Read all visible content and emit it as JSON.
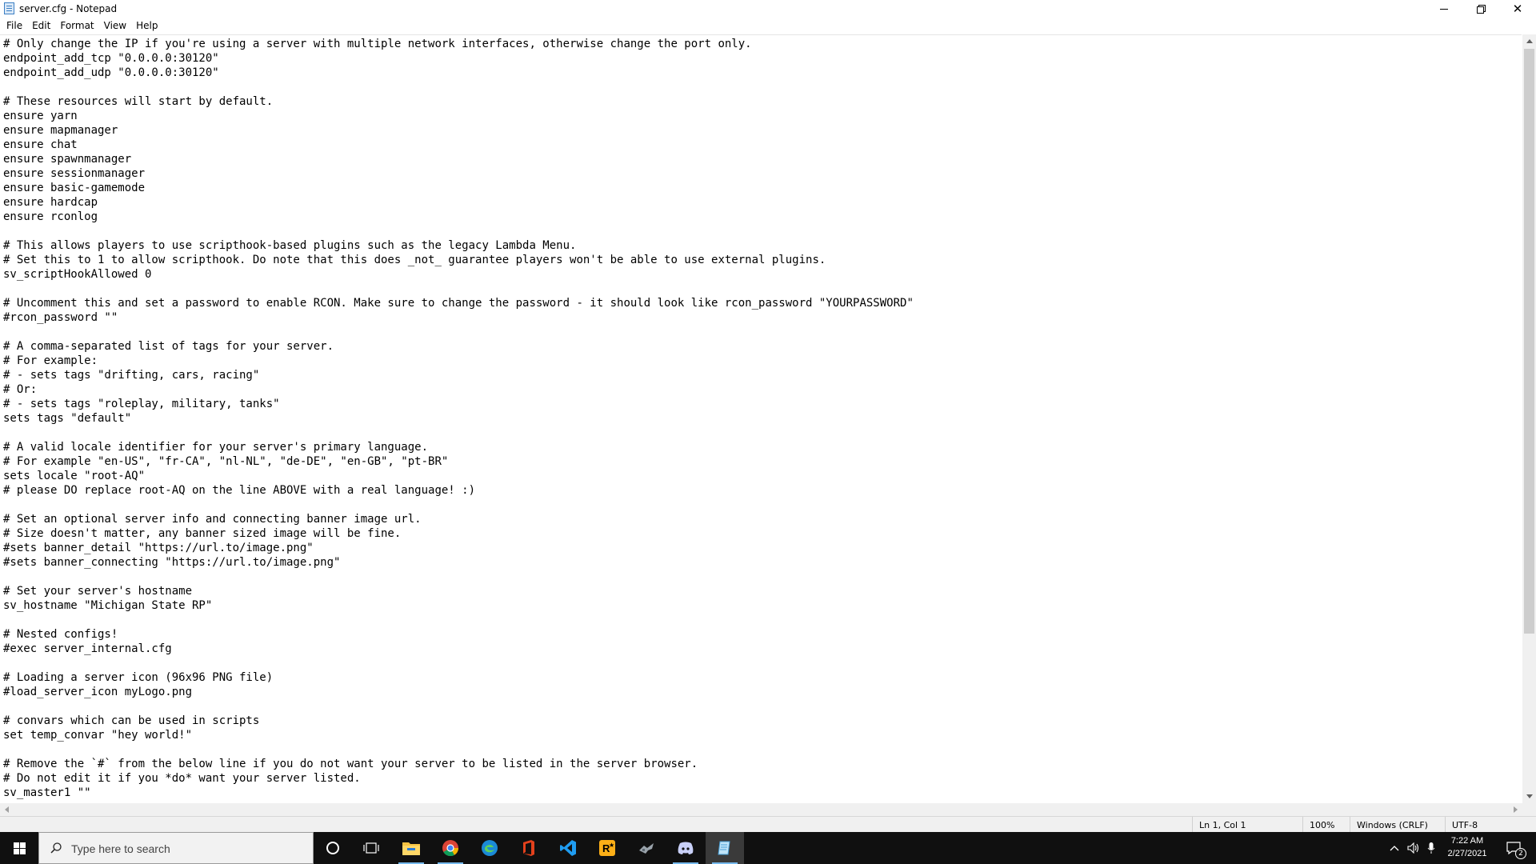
{
  "window": {
    "title": "server.cfg - Notepad",
    "close_glyph": "✕"
  },
  "menu": [
    {
      "label": "File"
    },
    {
      "label": "Edit"
    },
    {
      "label": "Format"
    },
    {
      "label": "View"
    },
    {
      "label": "Help"
    }
  ],
  "editor": {
    "lines": [
      "# Only change the IP if you're using a server with multiple network interfaces, otherwise change the port only.",
      "endpoint_add_tcp \"0.0.0.0:30120\"",
      "endpoint_add_udp \"0.0.0.0:30120\"",
      "",
      "# These resources will start by default.",
      "ensure yarn",
      "ensure mapmanager",
      "ensure chat",
      "ensure spawnmanager",
      "ensure sessionmanager",
      "ensure basic-gamemode",
      "ensure hardcap",
      "ensure rconlog",
      "",
      "# This allows players to use scripthook-based plugins such as the legacy Lambda Menu.",
      "# Set this to 1 to allow scripthook. Do note that this does _not_ guarantee players won't be able to use external plugins.",
      "sv_scriptHookAllowed 0",
      "",
      "# Uncomment this and set a password to enable RCON. Make sure to change the password - it should look like rcon_password \"YOURPASSWORD\"",
      "#rcon_password \"\"",
      "",
      "# A comma-separated list of tags for your server.",
      "# For example:",
      "# - sets tags \"drifting, cars, racing\"",
      "# Or:",
      "# - sets tags \"roleplay, military, tanks\"",
      "sets tags \"default\"",
      "",
      "# A valid locale identifier for your server's primary language.",
      "# For example \"en-US\", \"fr-CA\", \"nl-NL\", \"de-DE\", \"en-GB\", \"pt-BR\"",
      "sets locale \"root-AQ\"",
      "# please DO replace root-AQ on the line ABOVE with a real language! :)",
      "",
      "# Set an optional server info and connecting banner image url.",
      "# Size doesn't matter, any banner sized image will be fine.",
      "#sets banner_detail \"https://url.to/image.png\"",
      "#sets banner_connecting \"https://url.to/image.png\"",
      "",
      "# Set your server's hostname",
      "sv_hostname \"Michigan State RP\"",
      "",
      "# Nested configs!",
      "#exec server_internal.cfg",
      "",
      "# Loading a server icon (96x96 PNG file)",
      "#load_server_icon myLogo.png",
      "",
      "# convars which can be used in scripts",
      "set temp_convar \"hey world!\"",
      "",
      "# Remove the `#` from the below line if you do not want your server to be listed in the server browser.",
      "# Do not edit it if you *do* want your server listed.",
      "sv_master1 \"\""
    ]
  },
  "statusbar": {
    "position": "Ln 1, Col 1",
    "zoom": "100%",
    "line_ending": "Windows (CRLF)",
    "encoding": "UTF-8"
  },
  "taskbar": {
    "search_placeholder": "Type here to search",
    "pinned_icons": [
      "cortana-icon",
      "task-view-icon",
      "file-explorer-icon",
      "chrome-icon",
      "edge-icon",
      "office-icon",
      "vscode-icon",
      "rockstar-icon",
      "game-icon",
      "discord-icon",
      "notepad-icon"
    ],
    "clock": {
      "time": "7:22 AM",
      "date": "2/27/2021"
    },
    "notification_count": "2",
    "accent_color": "#76b9ed"
  }
}
